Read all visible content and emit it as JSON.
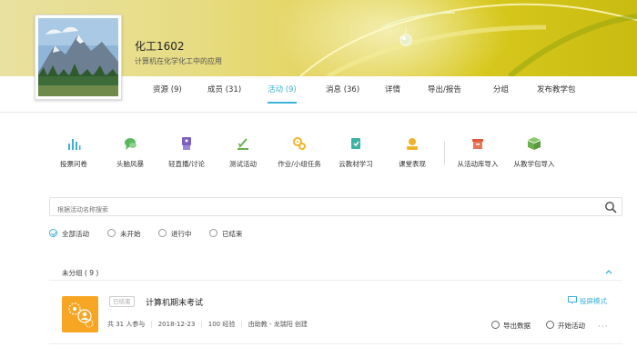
{
  "course": {
    "title": "化工1602",
    "subtitle": "计算机在化学化工中的应用"
  },
  "tabs": [
    {
      "label": "资源 (9)"
    },
    {
      "label": "成员 (31)"
    },
    {
      "label": "活动 (9)",
      "active": true
    },
    {
      "label": "消息 (36)"
    },
    {
      "label": "详情"
    },
    {
      "label": "导出/报告"
    },
    {
      "label": "分组"
    },
    {
      "label": "发布教学包"
    }
  ],
  "toolbar": [
    {
      "label": "投票问卷",
      "icon": "bar-chart-icon",
      "color": "#3db2d8"
    },
    {
      "label": "头脑风暴",
      "icon": "chat-bubble-icon",
      "color": "#5cb85c"
    },
    {
      "label": "轻直播/讨论",
      "icon": "live-icon",
      "color": "#7b5fc4"
    },
    {
      "label": "测试活动",
      "icon": "test-icon",
      "color": "#6ab04c"
    },
    {
      "label": "作业/小组任务",
      "icon": "gear-icon",
      "color": "#f0b429"
    },
    {
      "label": "云教材学习",
      "icon": "book-icon",
      "color": "#3bb3a3"
    },
    {
      "label": "课堂表现",
      "icon": "performance-icon",
      "color": "#f0b429"
    },
    {
      "label": "从活动库导入",
      "icon": "box-icon",
      "color": "#e05a3a"
    },
    {
      "label": "从教学包导入",
      "icon": "package-icon",
      "color": "#6ab04c"
    }
  ],
  "search": {
    "placeholder": "根据活动名称搜索"
  },
  "filters": [
    {
      "label": "全部活动",
      "selected": true
    },
    {
      "label": "未开始"
    },
    {
      "label": "进行中"
    },
    {
      "label": "已结束"
    }
  ],
  "group": {
    "label": "未分组 ( 9 )"
  },
  "activity": {
    "status": "已结束",
    "title": "计算机期末考试",
    "participants": "共 31 人参与",
    "date": "2018-12-23",
    "points": "100 经验",
    "creator": "由助教 - 龙瑞阳 创建",
    "projection": "投屏模式",
    "export": "导出数据",
    "start": "开始活动",
    "more": "···"
  },
  "colors": {
    "accent": "#3db2d8",
    "activity_icon_bg": "#f6a623"
  }
}
